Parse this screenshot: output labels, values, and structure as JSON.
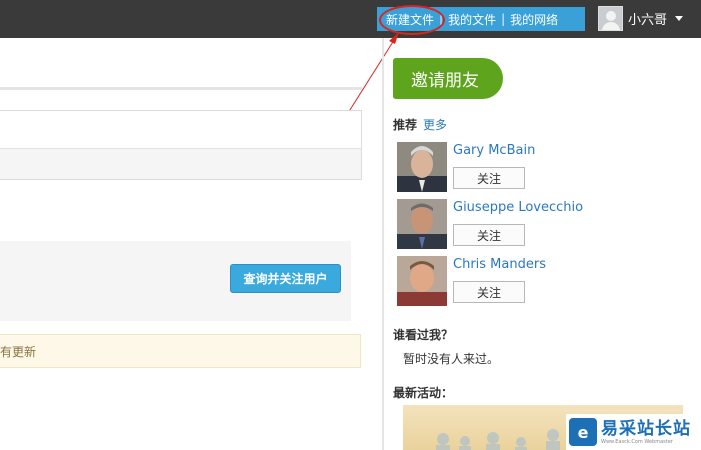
{
  "topbar": {
    "nav": [
      "新建文件",
      "我的文件",
      "我的网络"
    ],
    "separator": "|",
    "user_name": "小六哥"
  },
  "main": {
    "find_button": "查询并关注用户",
    "notice": "没有更新"
  },
  "sidebar": {
    "invite_button": "邀请朋友",
    "recommend_title": "推荐",
    "more_link": "更多",
    "people": [
      {
        "name": "Gary McBain",
        "follow": "关注"
      },
      {
        "name": "Giuseppe Lovecchio",
        "follow": "关注"
      },
      {
        "name": "Chris Manders",
        "follow": "关注"
      }
    ],
    "who_viewed_title": "谁看过我？",
    "who_viewed_text": "暂时没有人来过。",
    "activity_title": "最新活动："
  },
  "watermark": {
    "brand": "易采站长站",
    "sub": "Www.Easck.Com Webmaster"
  },
  "colors": {
    "topbar": "#3a3a3a",
    "nav_blue": "#3aa0d8",
    "invite_green": "#5ea41c",
    "link_blue": "#2a78c2",
    "annotation_red": "#d9251c"
  }
}
